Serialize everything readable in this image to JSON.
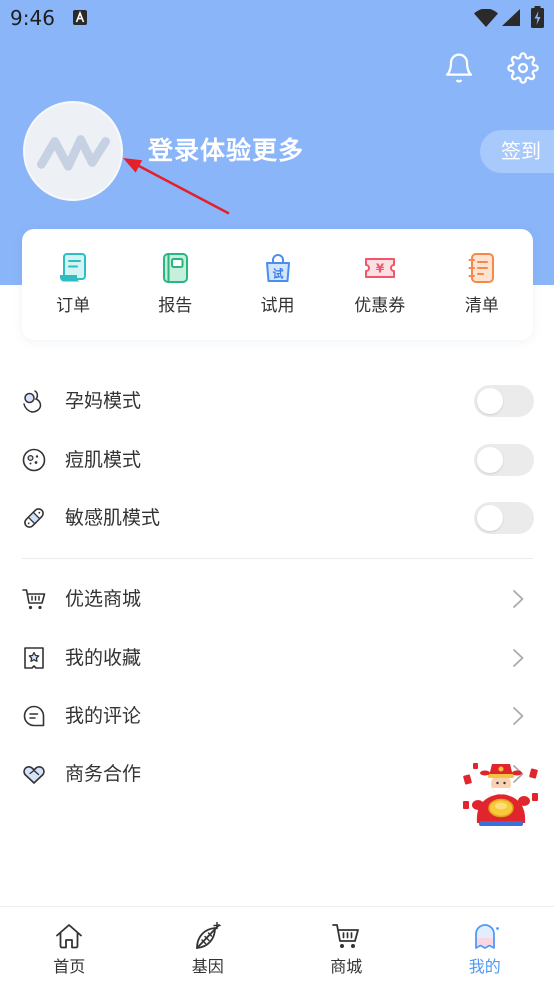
{
  "status_bar": {
    "time": "9:46",
    "icons": [
      "notification-a-icon",
      "wifi-icon",
      "signal-icon",
      "battery-charging-icon"
    ]
  },
  "header": {
    "background": "#8ab5f9",
    "login_prompt": "登录体验更多",
    "checkin_label": "签到",
    "icons": [
      "bell-icon",
      "gear-icon"
    ],
    "avatar_icon": "app-logo-icon"
  },
  "quick_actions": [
    {
      "label": "订单",
      "icon": "order-icon",
      "color": "#2fbcc2"
    },
    {
      "label": "报告",
      "icon": "report-icon",
      "color": "#2bb57f"
    },
    {
      "label": "试用",
      "icon": "trial-bag-icon",
      "color": "#4a8ff0",
      "glyph": "试"
    },
    {
      "label": "优惠券",
      "icon": "coupon-icon",
      "color": "#f0566a",
      "glyph": "¥"
    },
    {
      "label": "清单",
      "icon": "list-icon",
      "color": "#f3894a"
    }
  ],
  "modes": [
    {
      "label": "孕妈模式",
      "icon": "pregnancy-icon",
      "enabled": false
    },
    {
      "label": "痘肌模式",
      "icon": "acne-face-icon",
      "enabled": false
    },
    {
      "label": "敏感肌模式",
      "icon": "bandage-icon",
      "enabled": false
    }
  ],
  "menu": [
    {
      "label": "优选商城",
      "icon": "cart-icon"
    },
    {
      "label": "我的收藏",
      "icon": "favorite-star-icon"
    },
    {
      "label": "我的评论",
      "icon": "comment-icon"
    },
    {
      "label": "商务合作",
      "icon": "handshake-heart-icon"
    }
  ],
  "promo": {
    "icon": "god-of-wealth-mascot-icon"
  },
  "tabbar": {
    "active_color": "#4f9af7",
    "items": [
      {
        "label": "首页",
        "icon": "home-icon",
        "active": false
      },
      {
        "label": "基因",
        "icon": "gene-icon",
        "active": false
      },
      {
        "label": "商城",
        "icon": "cart-icon",
        "active": false
      },
      {
        "label": "我的",
        "icon": "profile-ghost-icon",
        "active": true
      }
    ]
  }
}
